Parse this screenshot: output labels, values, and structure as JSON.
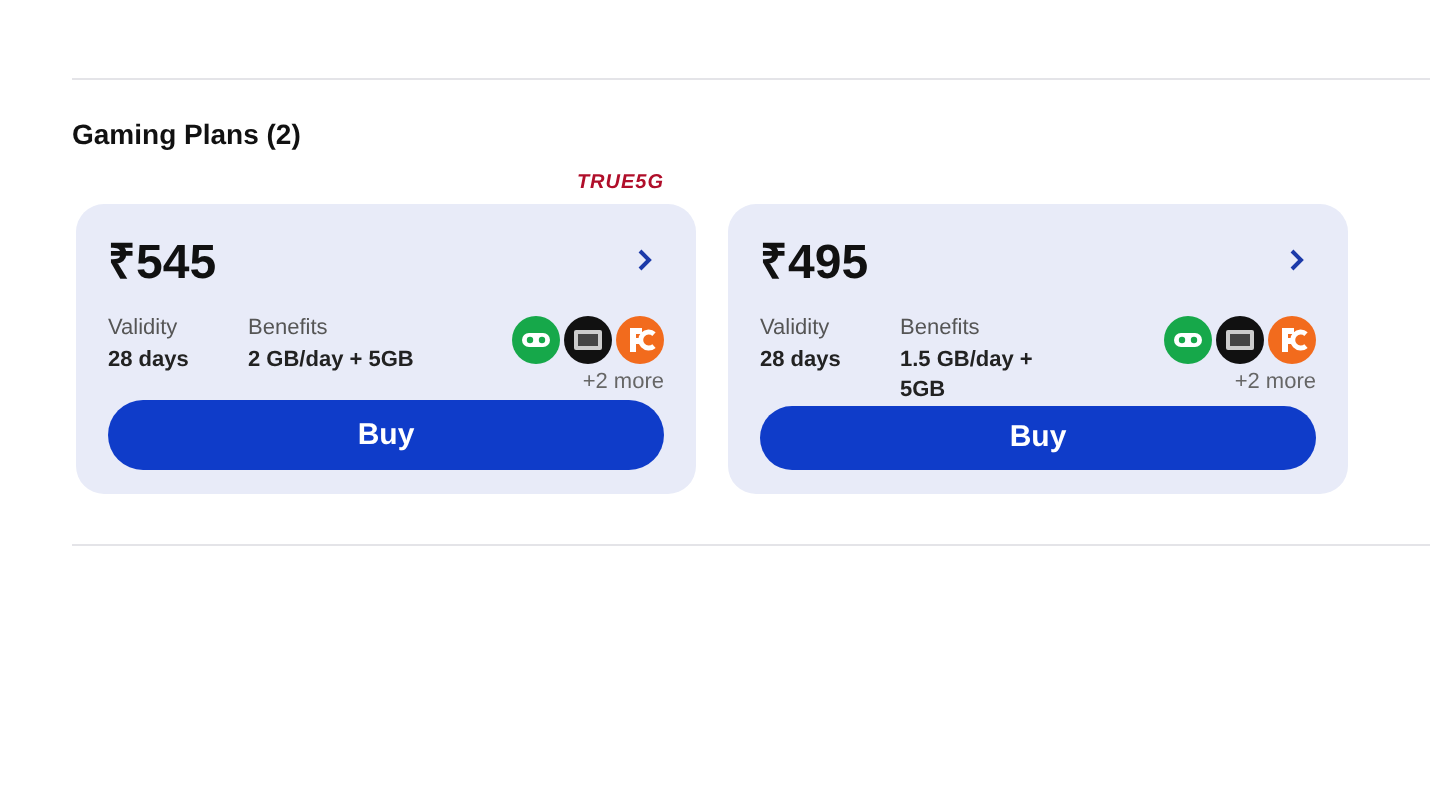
{
  "section": {
    "title": "Gaming Plans (2)"
  },
  "plans": [
    {
      "badge": "TRUE5G",
      "price": "₹545",
      "validity_label": "Validity",
      "validity": "28 days",
      "benefits_label": "Benefits",
      "benefits": "2 GB/day + 5GB",
      "more": "+2 more",
      "button": "Buy"
    },
    {
      "price": "₹495",
      "validity_label": "Validity",
      "validity": "28 days",
      "benefits_label": "Benefits",
      "benefits": "1.5 GB/day + 5GB",
      "more": "+2 more",
      "button": "Buy"
    }
  ]
}
